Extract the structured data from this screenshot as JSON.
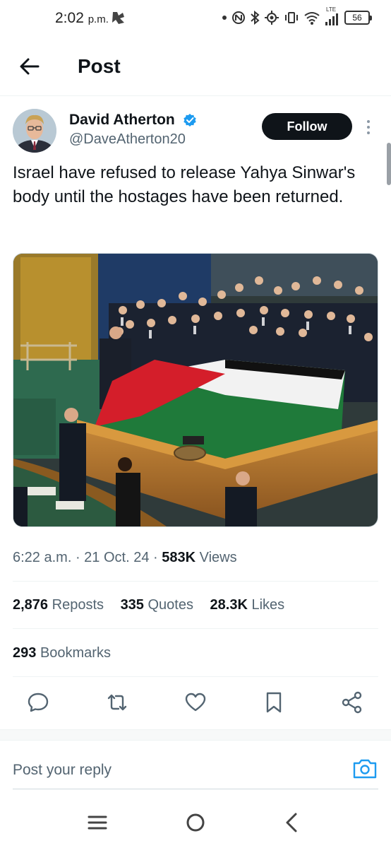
{
  "status_bar": {
    "time": "2:02",
    "time_suffix": "p.m.",
    "network": "LTE",
    "battery": "56"
  },
  "header": {
    "title": "Post"
  },
  "author": {
    "name": "David Atherton",
    "handle": "@DaveAtherton20",
    "verified": true,
    "follow_label": "Follow"
  },
  "post": {
    "text": "Israel have refused to release Yahya Sinwar's body until the hostages have been returned.",
    "time": "6:22 a.m.",
    "date": "21 Oct. 24",
    "views_count": "583K",
    "views_label": "Views"
  },
  "stats": {
    "reposts_count": "2,876",
    "reposts_label": "Reposts",
    "quotes_count": "335",
    "quotes_label": "Quotes",
    "likes_count": "28.3K",
    "likes_label": "Likes",
    "bookmarks_count": "293",
    "bookmarks_label": "Bookmarks"
  },
  "actions": [
    "reply-icon",
    "repost-icon",
    "like-icon",
    "bookmark-icon",
    "share-icon"
  ],
  "reply": {
    "placeholder": "Post your reply"
  },
  "colors": {
    "accent": "#1d9bf0",
    "text_primary": "#0f1419",
    "text_secondary": "#536471",
    "follow_bg": "#0f1419"
  }
}
